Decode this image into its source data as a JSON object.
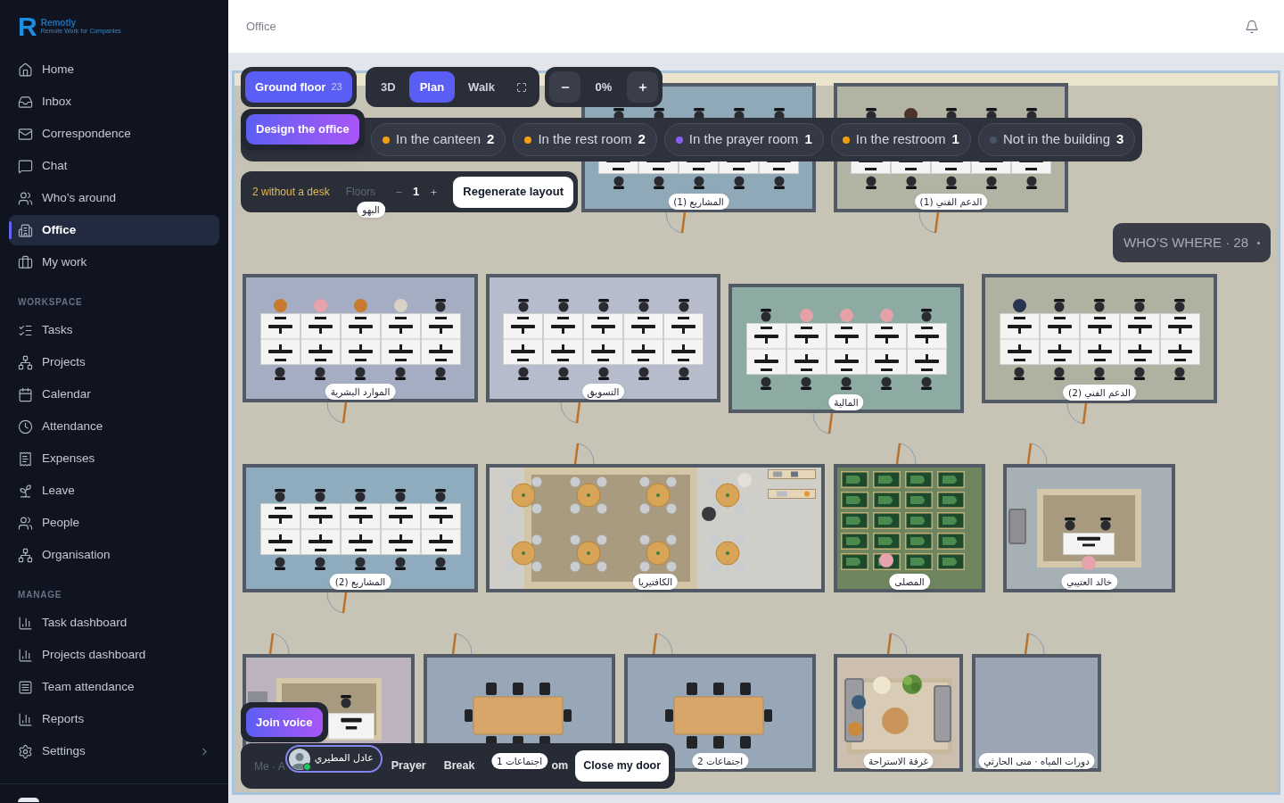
{
  "sidebar": {
    "logo": {
      "mark": "R",
      "name": "Remotly",
      "tagline": "Remote Work for Companies"
    },
    "sections": [
      {
        "items": [
          {
            "label": "Home",
            "selected": false,
            "submenu": false
          },
          {
            "label": "Inbox",
            "selected": false,
            "submenu": false
          },
          {
            "label": "Correspondence",
            "selected": false,
            "submenu": false
          },
          {
            "label": "Chat",
            "selected": false,
            "submenu": false
          },
          {
            "label": "Who’s around",
            "selected": false,
            "submenu": false
          },
          {
            "label": "Office",
            "selected": true,
            "submenu": false
          },
          {
            "label": "My work",
            "selected": false,
            "submenu": false
          }
        ]
      },
      {
        "title": "WORKSPACE",
        "items": [
          {
            "label": "Tasks",
            "selected": false,
            "submenu": false
          },
          {
            "label": "Projects",
            "selected": false,
            "submenu": false
          },
          {
            "label": "Calendar",
            "selected": false,
            "submenu": false
          },
          {
            "label": "Attendance",
            "selected": false,
            "submenu": false
          },
          {
            "label": "Expenses",
            "selected": false,
            "submenu": false
          },
          {
            "label": "Leave",
            "selected": false,
            "submenu": false
          },
          {
            "label": "People",
            "selected": false,
            "submenu": false
          },
          {
            "label": "Organisation",
            "selected": false,
            "submenu": false
          }
        ]
      },
      {
        "title": "MANAGE",
        "items": [
          {
            "label": "Task dashboard",
            "selected": false,
            "submenu": false
          },
          {
            "label": "Projects dashboard",
            "selected": false,
            "submenu": false
          },
          {
            "label": "Team attendance",
            "selected": false,
            "submenu": false
          },
          {
            "label": "Reports",
            "selected": false,
            "submenu": false
          },
          {
            "label": "Settings",
            "selected": false,
            "submenu": true
          }
        ]
      }
    ]
  },
  "header": {
    "breadcrumb": "Office"
  },
  "floor_controls": {
    "floor": {
      "label": "Ground floor",
      "count": "23"
    },
    "view_modes": [
      {
        "label": "3D",
        "selected": false
      },
      {
        "label": "Plan",
        "selected": true
      },
      {
        "label": "Walk",
        "selected": false
      }
    ],
    "zoom": "0%",
    "design_button": "Design the office",
    "without_desk": "2 without a desk",
    "floors_label": "Floors",
    "floors_value": "1",
    "regenerate_button": "Regenerate layout"
  },
  "presence": [
    {
      "label": "In the canteen",
      "count": "2",
      "color": "#f59e0b"
    },
    {
      "label": "In the rest room",
      "count": "2",
      "color": "#f59e0b"
    },
    {
      "label": "In the prayer room",
      "count": "1",
      "color": "#8b5cf6"
    },
    {
      "label": "In the restroom",
      "count": "1",
      "color": "#f59e0b"
    },
    {
      "label": "Not in the building",
      "count": "3",
      "color": "#475569"
    }
  ],
  "whos_where": "WHO’S WHERE · 28",
  "rooms": [
    {
      "label": "الدعم الفني (1)",
      "kind": "desks",
      "seats": [
        {
          "occupied": false
        },
        {
          "occupied": true,
          "color": "#4a3426"
        },
        {
          "occupied": false
        },
        {
          "occupied": false
        },
        {
          "occupied": false
        },
        {
          "occupied": false
        },
        {
          "occupied": false
        },
        {
          "occupied": false
        },
        {
          "occupied": false
        },
        {
          "occupied": false
        }
      ]
    },
    {
      "label": "المشاريع (1)",
      "kind": "desks",
      "seats": [
        {
          "occupied": false
        },
        {
          "occupied": false
        },
        {
          "occupied": false
        },
        {
          "occupied": false
        },
        {
          "occupied": false
        },
        {
          "occupied": false
        },
        {
          "occupied": false
        },
        {
          "occupied": false
        },
        {
          "occupied": false
        },
        {
          "occupied": false
        }
      ]
    },
    {
      "label": "البهو",
      "kind": "lobby"
    },
    {
      "label": "الدعم الفني (2)",
      "kind": "desks",
      "seats": [
        {
          "occupied": true,
          "color": "#27344f"
        },
        {
          "occupied": false
        },
        {
          "occupied": false
        },
        {
          "occupied": false
        },
        {
          "occupied": false
        },
        {
          "occupied": false
        },
        {
          "occupied": false
        },
        {
          "occupied": false
        },
        {
          "occupied": false
        },
        {
          "occupied": false
        }
      ]
    },
    {
      "label": "المالية",
      "kind": "desks",
      "seats": [
        {
          "occupied": false
        },
        {
          "occupied": true,
          "color": "#e5a1a8"
        },
        {
          "occupied": true,
          "color": "#e5a1a8"
        },
        {
          "occupied": true,
          "color": "#e5a1a8"
        },
        {
          "occupied": false
        },
        {
          "occupied": false
        },
        {
          "occupied": false
        },
        {
          "occupied": false
        },
        {
          "occupied": false
        },
        {
          "occupied": false
        }
      ]
    },
    {
      "label": "التسويق",
      "kind": "desks",
      "seats": [
        {
          "occupied": false
        },
        {
          "occupied": false
        },
        {
          "occupied": false
        },
        {
          "occupied": false
        },
        {
          "occupied": false
        },
        {
          "occupied": false
        },
        {
          "occupied": false
        },
        {
          "occupied": false
        },
        {
          "occupied": false
        },
        {
          "occupied": false
        }
      ]
    },
    {
      "label": "الموارد البشرية",
      "kind": "desks",
      "seats": [
        {
          "occupied": true,
          "color": "#c87a2e"
        },
        {
          "occupied": true,
          "color": "#e6a3ab"
        },
        {
          "occupied": true,
          "color": "#c87a2e"
        },
        {
          "occupied": true,
          "color": "#d9d3c7"
        },
        {
          "occupied": false
        },
        {
          "occupied": false
        },
        {
          "occupied": false
        },
        {
          "occupied": false
        },
        {
          "occupied": false
        },
        {
          "occupied": false
        }
      ]
    },
    {
      "label": "خالد العتيبي",
      "kind": "office",
      "people": [
        {
          "color": "#e6a3ab"
        }
      ]
    },
    {
      "label": "المصلى",
      "kind": "prayer",
      "people": [
        {
          "color": "#e6a3ab"
        }
      ]
    },
    {
      "label": "الكافتيريا",
      "kind": "cafeteria",
      "people": [
        {
          "color": "#e4e0d8"
        },
        {
          "color": "#3a3a3e"
        }
      ]
    },
    {
      "label": "المشاريع (2)",
      "kind": "desks",
      "seats": [
        {
          "occupied": false
        },
        {
          "occupied": false
        },
        {
          "occupied": false
        },
        {
          "occupied": false
        },
        {
          "occupied": false
        },
        {
          "occupied": false
        },
        {
          "occupied": false
        },
        {
          "occupied": false
        },
        {
          "occupied": false
        },
        {
          "occupied": false
        }
      ]
    },
    {
      "label": "دورات المياه · منى الحارثي",
      "kind": "restroom"
    },
    {
      "label": "غرفة الاستراحة",
      "kind": "lounge",
      "people": [
        {
          "color": "#3c5a7a"
        },
        {
          "color": "#c98a3c"
        }
      ]
    },
    {
      "label": "اجتماعات 2",
      "kind": "meeting"
    },
    {
      "label": "اجتماعات 1",
      "kind": "meeting"
    },
    {
      "kind": "workroom"
    }
  ],
  "voice_bar": {
    "join_button": "Join voice",
    "me_label": "Me · A",
    "user": {
      "name": "عادل المطيري",
      "online": true
    },
    "actions": [
      "Prayer",
      "Break",
      "om"
    ],
    "close_door_button": "Close my door"
  }
}
